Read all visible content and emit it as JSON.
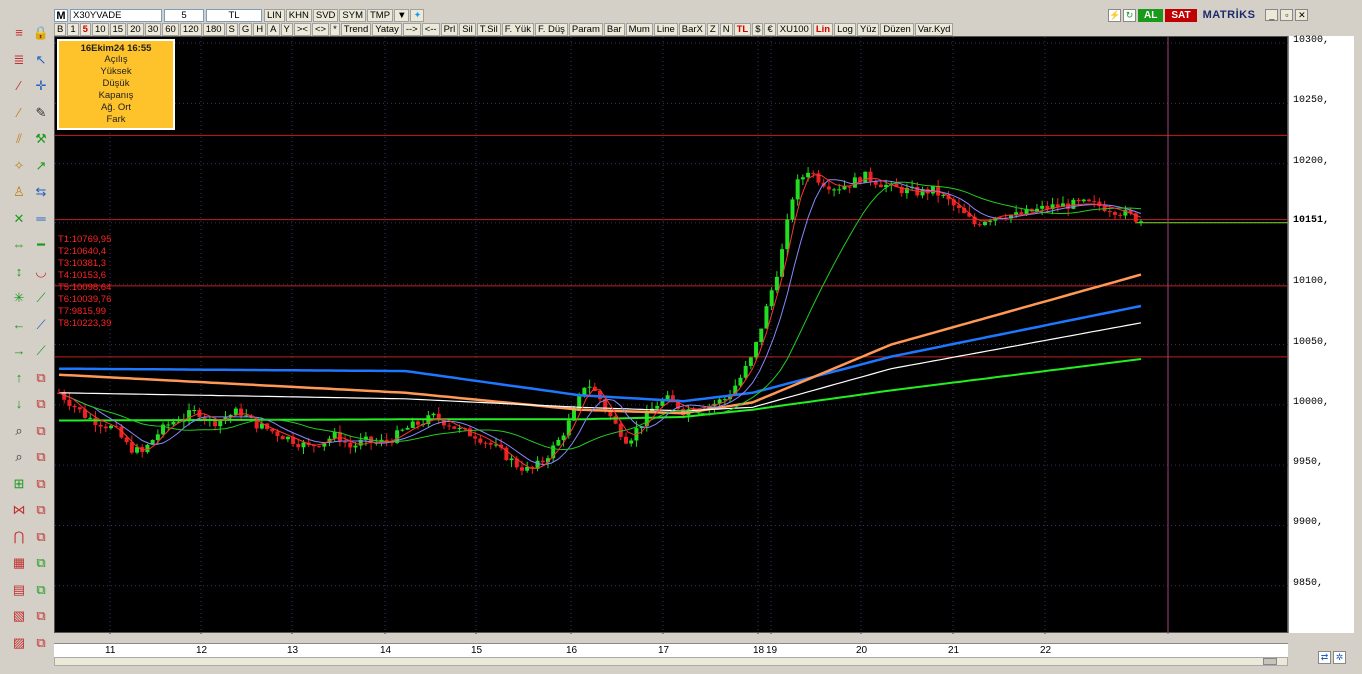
{
  "toolbar": {
    "logo": "M",
    "symbol": "X30YVADE",
    "period": "5",
    "currency": "TL",
    "row1_buttons": [
      "LIN",
      "KHN",
      "SVD",
      "SYM",
      "TMP"
    ],
    "row2_buttons": [
      "B",
      "1",
      "5",
      "10",
      "15",
      "20",
      "30",
      "60",
      "120",
      "180",
      "S",
      "G",
      "H",
      "A",
      "Y",
      "><",
      "<>",
      "*",
      "Trend",
      "Yatay",
      "-->",
      "<--",
      "Prl",
      "Sil",
      "T.Sil",
      "F. Yük",
      "F. Düş",
      "Param",
      "Bar",
      "Mum",
      "Line",
      "BarX",
      "Z",
      "N",
      "TL",
      "$",
      "€",
      "XU100",
      "Lin",
      "Log",
      "Yüz",
      "Düzen",
      "Var.Kyd"
    ],
    "active_period": "5",
    "al_label": "AL",
    "sat_label": "SAT",
    "brand": "MATRİKS"
  },
  "info_box": {
    "title": "16Ekim24 16:55",
    "rows": [
      "Açılış",
      "Yüksek",
      "Düşük",
      "Kapanış",
      "Ağ. Ort",
      "Fark"
    ]
  },
  "targets": [
    "T1:10769,95",
    "T2:10640,4",
    "T3:10381,3",
    "T4:10153,6",
    "T5:10098,64",
    "T6:10039,76",
    "T7:9815,99",
    "T8:10223,39"
  ],
  "yaxis": {
    "ticks": [
      "10300,",
      "10250,",
      "10200,",
      "10151,",
      "10100,",
      "10050,",
      "10000,",
      "9950,",
      "9900,",
      "9850,"
    ],
    "current_price": "10151,"
  },
  "xaxis": {
    "ticks": [
      "11",
      "12",
      "13",
      "14",
      "15",
      "16",
      "17",
      "18",
      "19",
      "20",
      "21",
      "22"
    ]
  },
  "colors": {
    "up": "#22dd22",
    "down": "#ee2222",
    "ma_blue": "#1e78ff",
    "ma_orange": "#ff9955",
    "ma_white": "#ffffff",
    "ma_green": "#22ee22",
    "ma_thin_blue": "#8888ff",
    "ma_thin_green": "#22cc22",
    "hline": "#c02020",
    "cursor": "#a04080"
  },
  "chart_data": {
    "type": "candlestick",
    "x": [
      "11",
      "12",
      "13",
      "14",
      "15",
      "16",
      "17",
      "18",
      "19",
      "20",
      "21",
      "22"
    ],
    "ylim": [
      9810,
      10305
    ],
    "current_price": 10151,
    "horizontal_levels": [
      10223.39,
      10153.6,
      10098.64,
      10039.76
    ],
    "price_path": [
      [
        0,
        10010
      ],
      [
        4,
        10000
      ],
      [
        8,
        9990
      ],
      [
        12,
        9985
      ],
      [
        16,
        9980
      ],
      [
        20,
        9965
      ],
      [
        24,
        9960
      ],
      [
        28,
        9975
      ],
      [
        32,
        9985
      ],
      [
        36,
        9990
      ],
      [
        40,
        9995
      ],
      [
        44,
        9985
      ],
      [
        48,
        9990
      ],
      [
        52,
        9995
      ],
      [
        56,
        9985
      ],
      [
        60,
        9980
      ],
      [
        64,
        9975
      ],
      [
        68,
        9970
      ],
      [
        72,
        9965
      ],
      [
        76,
        9970
      ],
      [
        80,
        9975
      ],
      [
        84,
        9965
      ],
      [
        88,
        9970
      ],
      [
        92,
        9968
      ],
      [
        96,
        9972
      ],
      [
        100,
        9980
      ],
      [
        104,
        9985
      ],
      [
        108,
        9990
      ],
      [
        112,
        9985
      ],
      [
        116,
        9978
      ],
      [
        120,
        9975
      ],
      [
        124,
        9968
      ],
      [
        128,
        9960
      ],
      [
        132,
        9950
      ],
      [
        136,
        9945
      ],
      [
        140,
        9955
      ],
      [
        144,
        9970
      ],
      [
        148,
        9990
      ],
      [
        152,
        10020
      ],
      [
        156,
        10005
      ],
      [
        160,
        9985
      ],
      [
        164,
        9970
      ],
      [
        168,
        9985
      ],
      [
        172,
        10000
      ],
      [
        176,
        10005
      ],
      [
        180,
        9995
      ],
      [
        184,
        9998
      ],
      [
        188,
        10000
      ],
      [
        192,
        10005
      ],
      [
        196,
        10020
      ],
      [
        200,
        10040
      ],
      [
        204,
        10080
      ],
      [
        208,
        10120
      ],
      [
        212,
        10180
      ],
      [
        216,
        10195
      ],
      [
        220,
        10185
      ],
      [
        224,
        10180
      ],
      [
        228,
        10183
      ],
      [
        232,
        10190
      ],
      [
        236,
        10185
      ],
      [
        240,
        10180
      ],
      [
        244,
        10178
      ],
      [
        248,
        10176
      ],
      [
        252,
        10178
      ],
      [
        256,
        10170
      ],
      [
        260,
        10160
      ],
      [
        264,
        10150
      ],
      [
        268,
        10155
      ],
      [
        272,
        10158
      ],
      [
        276,
        10157
      ],
      [
        280,
        10160
      ],
      [
        284,
        10163
      ],
      [
        288,
        10165
      ],
      [
        292,
        10166
      ],
      [
        296,
        10167
      ],
      [
        300,
        10165
      ],
      [
        304,
        10162
      ],
      [
        308,
        10158
      ],
      [
        312,
        10153
      ]
    ],
    "series": [
      {
        "name": "",
        "color": "#1e78ff",
        "values": [
          [
            0,
            10030
          ],
          [
            100,
            10028
          ],
          [
            150,
            10008
          ],
          [
            180,
            10003
          ],
          [
            200,
            10010
          ],
          [
            240,
            10040
          ],
          [
            312,
            10082
          ]
        ]
      },
      {
        "name": "",
        "color": "#ff9955",
        "values": [
          [
            0,
            10025
          ],
          [
            100,
            10010
          ],
          [
            150,
            9996
          ],
          [
            180,
            9993
          ],
          [
            200,
            10002
          ],
          [
            240,
            10050
          ],
          [
            312,
            10108
          ]
        ]
      },
      {
        "name": "",
        "color": "#ffffff",
        "values": [
          [
            0,
            10010
          ],
          [
            100,
            10005
          ],
          [
            150,
            9998
          ],
          [
            180,
            9995
          ],
          [
            200,
            9998
          ],
          [
            240,
            10030
          ],
          [
            312,
            10068
          ]
        ]
      },
      {
        "name": "",
        "color": "#22ee22",
        "values": [
          [
            0,
            9987
          ],
          [
            100,
            9988
          ],
          [
            150,
            9988
          ],
          [
            180,
            9990
          ],
          [
            200,
            9996
          ],
          [
            240,
            10012
          ],
          [
            312,
            10038
          ]
        ]
      }
    ]
  }
}
